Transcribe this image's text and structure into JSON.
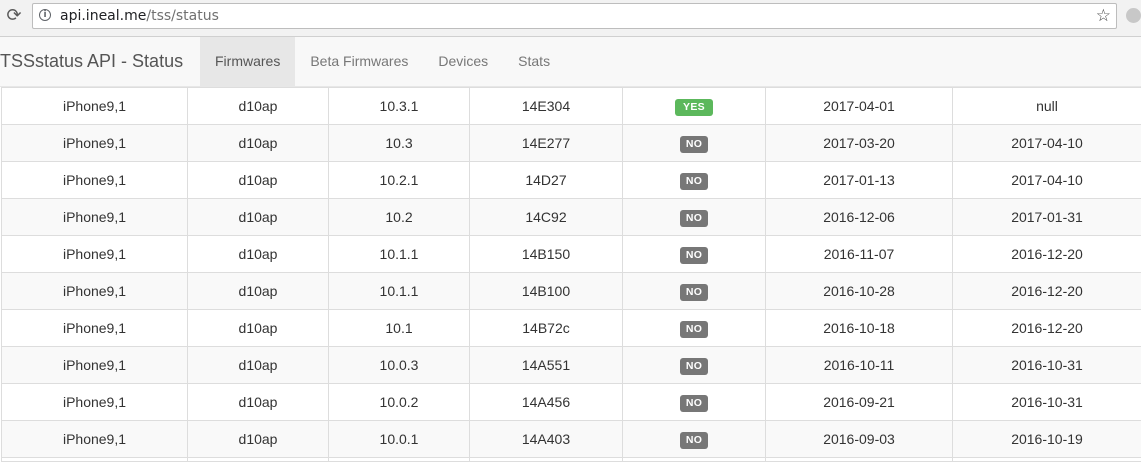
{
  "browser": {
    "url_host": "api.ineal.me",
    "url_path": "/tss/status",
    "reload_glyph": "⟳",
    "info_glyph": "i",
    "star_glyph": "☆"
  },
  "navbar": {
    "brand": "TSSstatus API - Status",
    "items": [
      {
        "label": "Firmwares",
        "active": true
      },
      {
        "label": "Beta Firmwares",
        "active": false
      },
      {
        "label": "Devices",
        "active": false
      },
      {
        "label": "Stats",
        "active": false
      }
    ]
  },
  "colors": {
    "yes": "#5cb85c",
    "no": "#777777"
  },
  "table": {
    "rows": [
      {
        "device": "iPhone9,1",
        "model": "d10ap",
        "version": "10.3.1",
        "build": "14E304",
        "signed": "YES",
        "released": "2017-04-01",
        "unsigned": "null"
      },
      {
        "device": "iPhone9,1",
        "model": "d10ap",
        "version": "10.3",
        "build": "14E277",
        "signed": "NO",
        "released": "2017-03-20",
        "unsigned": "2017-04-10"
      },
      {
        "device": "iPhone9,1",
        "model": "d10ap",
        "version": "10.2.1",
        "build": "14D27",
        "signed": "NO",
        "released": "2017-01-13",
        "unsigned": "2017-04-10"
      },
      {
        "device": "iPhone9,1",
        "model": "d10ap",
        "version": "10.2",
        "build": "14C92",
        "signed": "NO",
        "released": "2016-12-06",
        "unsigned": "2017-01-31"
      },
      {
        "device": "iPhone9,1",
        "model": "d10ap",
        "version": "10.1.1",
        "build": "14B150",
        "signed": "NO",
        "released": "2016-11-07",
        "unsigned": "2016-12-20"
      },
      {
        "device": "iPhone9,1",
        "model": "d10ap",
        "version": "10.1.1",
        "build": "14B100",
        "signed": "NO",
        "released": "2016-10-28",
        "unsigned": "2016-12-20"
      },
      {
        "device": "iPhone9,1",
        "model": "d10ap",
        "version": "10.1",
        "build": "14B72c",
        "signed": "NO",
        "released": "2016-10-18",
        "unsigned": "2016-12-20"
      },
      {
        "device": "iPhone9,1",
        "model": "d10ap",
        "version": "10.0.3",
        "build": "14A551",
        "signed": "NO",
        "released": "2016-10-11",
        "unsigned": "2016-10-31"
      },
      {
        "device": "iPhone9,1",
        "model": "d10ap",
        "version": "10.0.2",
        "build": "14A456",
        "signed": "NO",
        "released": "2016-09-21",
        "unsigned": "2016-10-31"
      },
      {
        "device": "iPhone9,1",
        "model": "d10ap",
        "version": "10.0.1",
        "build": "14A403",
        "signed": "NO",
        "released": "2016-09-03",
        "unsigned": "2016-10-19"
      }
    ]
  }
}
